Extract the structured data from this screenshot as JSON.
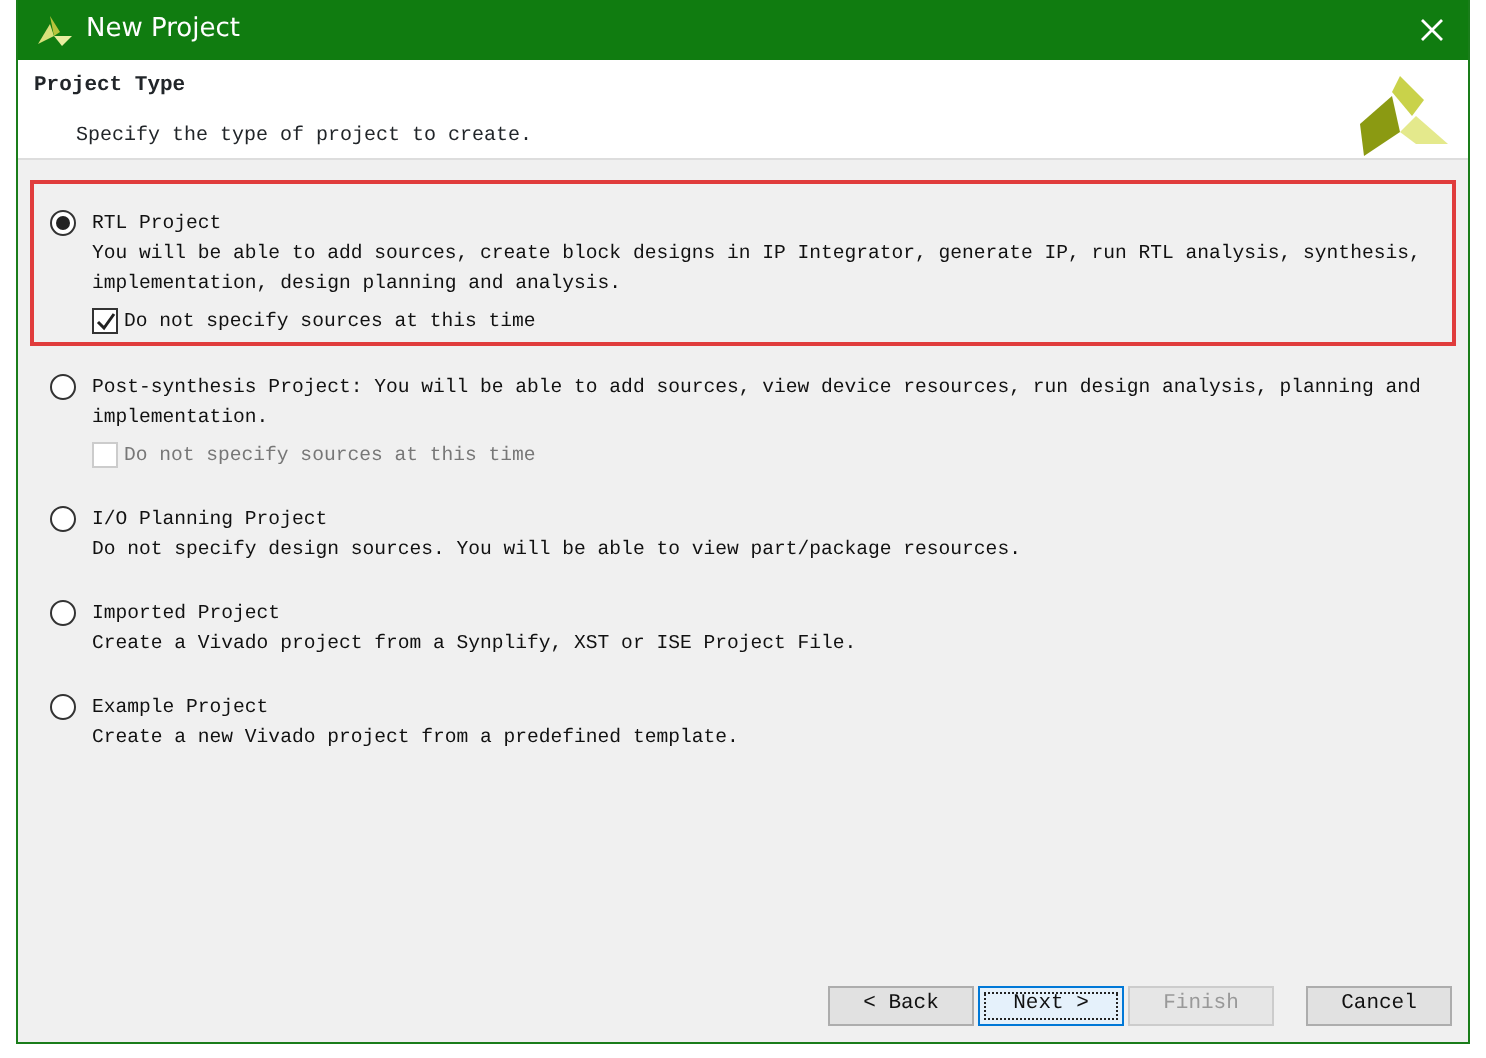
{
  "window": {
    "title": "New Project"
  },
  "header": {
    "title": "Project Type",
    "subtitle": "Specify the type of project to create."
  },
  "options": [
    {
      "title": "RTL Project",
      "description": "You will be able to add sources, create block designs in IP Integrator, generate IP, run RTL analysis, synthesis, implementation, design planning and analysis.",
      "selected": true,
      "highlighted": true,
      "checkbox": {
        "label": "Do not specify sources at this time",
        "checked": true,
        "disabled": false
      }
    },
    {
      "title": "Post-synthesis Project:",
      "description": "You will be able to add sources, view device resources, run design analysis, planning and implementation.",
      "selected": false,
      "highlighted": false,
      "inline": true,
      "checkbox": {
        "label": "Do not specify sources at this time",
        "checked": false,
        "disabled": true
      }
    },
    {
      "title": "I/O Planning Project",
      "description": "Do not specify design sources. You will be able to view part/package resources.",
      "selected": false,
      "highlighted": false
    },
    {
      "title": "Imported Project",
      "description": "Create a Vivado project from a Synplify, XST or ISE Project File.",
      "selected": false,
      "highlighted": false
    },
    {
      "title": "Example Project",
      "description": "Create a new Vivado project from a predefined template.",
      "selected": false,
      "highlighted": false
    }
  ],
  "buttons": [
    {
      "label": "< Back",
      "disabled": false,
      "focused": false
    },
    {
      "label": "Next >",
      "disabled": false,
      "focused": true
    },
    {
      "label": "Finish",
      "disabled": true,
      "focused": false
    },
    {
      "label": "Cancel",
      "disabled": false,
      "focused": false
    }
  ]
}
